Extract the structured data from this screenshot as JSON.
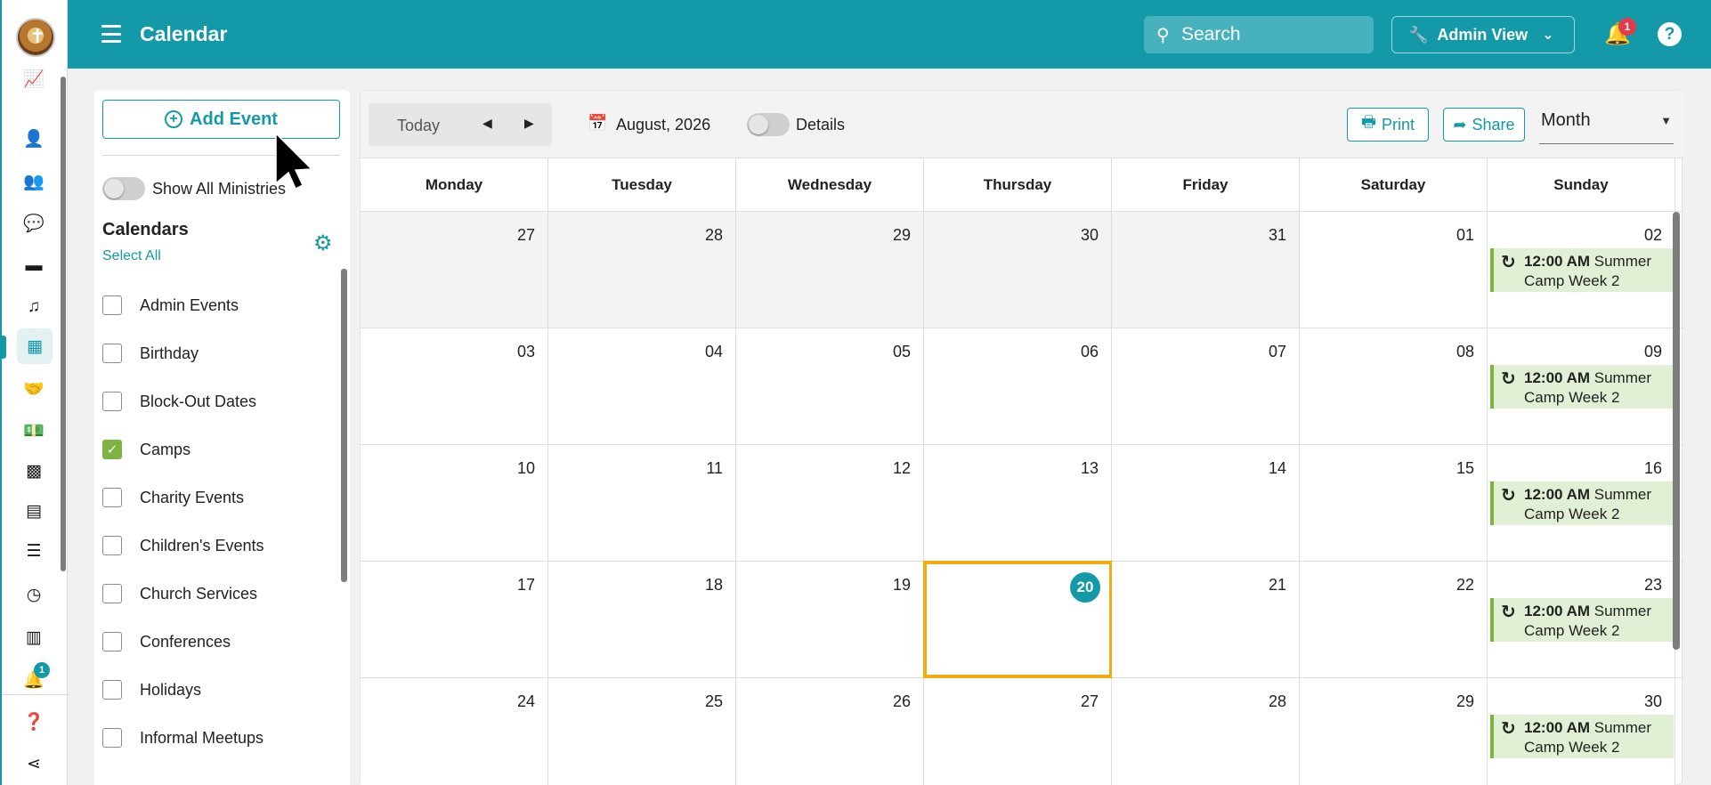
{
  "topbar": {
    "title": "Calendar",
    "search_placeholder": "Search",
    "admin_view_label": "Admin View",
    "notification_count": "1",
    "help_label": "?"
  },
  "rail": {
    "notification_count": "1",
    "icons": [
      "chart-line-icon",
      "user-icon",
      "users-icon",
      "chat-icon",
      "calendar-alt-icon",
      "music-icon",
      "calendar-icon",
      "handshake-icon",
      "money-icon",
      "qr-icon",
      "id-card-icon",
      "checklist-icon",
      "clock-icon",
      "bar-chart-icon",
      "bell-icon",
      "help-icon",
      "share-icon"
    ]
  },
  "sidebar": {
    "add_event_label": "Add Event",
    "show_all_label": "Show All Ministries",
    "calendars_heading": "Calendars",
    "select_all_label": "Select All",
    "calendars": [
      {
        "label": "Admin Events",
        "checked": false
      },
      {
        "label": "Birthday",
        "checked": false
      },
      {
        "label": "Block-Out Dates",
        "checked": false
      },
      {
        "label": "Camps",
        "checked": true
      },
      {
        "label": "Charity Events",
        "checked": false
      },
      {
        "label": "Children's Events",
        "checked": false
      },
      {
        "label": "Church Services",
        "checked": false
      },
      {
        "label": "Conferences",
        "checked": false
      },
      {
        "label": "Holidays",
        "checked": false
      },
      {
        "label": "Informal Meetups",
        "checked": false
      }
    ]
  },
  "toolbar": {
    "today_label": "Today",
    "prev_label": "◀",
    "next_label": "▶",
    "date_label": "August, 2026",
    "details_label": "Details",
    "print_label": "Print",
    "share_label": "Share",
    "view_value": "Month"
  },
  "calendar": {
    "weekdays": [
      "Monday",
      "Tuesday",
      "Wednesday",
      "Thursday",
      "Friday",
      "Saturday",
      "Sunday"
    ],
    "weeks": [
      [
        "27",
        "28",
        "29",
        "30",
        "31",
        "01",
        "02"
      ],
      [
        "03",
        "04",
        "05",
        "06",
        "07",
        "08",
        "09"
      ],
      [
        "10",
        "11",
        "12",
        "13",
        "14",
        "15",
        "16"
      ],
      [
        "17",
        "18",
        "19",
        "20",
        "21",
        "22",
        "23"
      ],
      [
        "24",
        "25",
        "26",
        "27",
        "28",
        "29",
        "30"
      ]
    ],
    "other_month_cells": [
      [
        0,
        0
      ],
      [
        0,
        1
      ],
      [
        0,
        2
      ],
      [
        0,
        3
      ],
      [
        0,
        4
      ]
    ],
    "today_cell": [
      3,
      3
    ],
    "event_time": "12:00 AM",
    "event_title": "Summer Camp Week 2",
    "colors": {
      "accent": "#1499a8",
      "event_bg": "#e1efd4",
      "event_border": "#7cb342",
      "today_outline": "#f0ac13"
    }
  }
}
